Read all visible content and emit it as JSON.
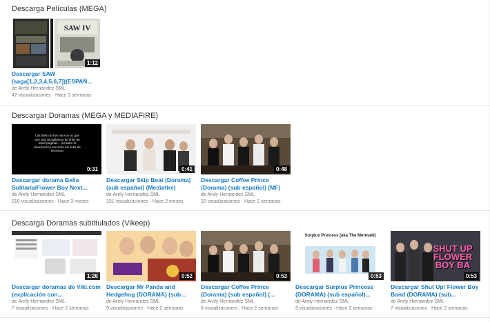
{
  "sections": [
    {
      "title": "Descarga Películas (MEGA)",
      "videos": [
        {
          "title": "Descargar SAW (saga[1,2,3,4,5,6,7])(ESPAÑ...",
          "channel": "de Arely Hernandez SML",
          "stats": "42 visualizaciones · Hace 2 semanas",
          "duration": "1:12"
        }
      ]
    },
    {
      "title": "Descargar Doramas (MEGA y MEDIAFIRE)",
      "videos": [
        {
          "title": "Descargar dorama Bella Solitaria/Flower Boy Next...",
          "channel": "de Arely Hernandez SML",
          "stats": "210 visualizaciones · Hace 3 meses",
          "duration": "0:31",
          "thumb_text": "Los links no son mios si no que son una recopilacion de links de otras paginas... (el autor lo desconozco encontre los links de terceros)"
        },
        {
          "title": "Descargar Skip Beat (Dorama) (sub español) (Mediafire)",
          "channel": "de Arely Hernandez SML",
          "stats": "151 visualizaciones · Hace 2 meses",
          "duration": "0:41"
        },
        {
          "title": "Descargar Coffee Prince (Dorama) (sub español) (MF)",
          "channel": "de Arely Hernandez SML",
          "stats": "20 visualizaciones · Hace 2 semanas",
          "duration": "0:48"
        }
      ]
    },
    {
      "title": "Descarga Doramas subtitulados (Vikeep)",
      "videos": [
        {
          "title": "Descargar doramas de Viki.com (explicación con...",
          "channel": "de Arely Hernandez SML",
          "stats": "7 visualizaciones · Hace 2 semanas",
          "duration": "1:26"
        },
        {
          "title": "Descargar Mr Panda and Hedgehog (DORAMA) (sub...",
          "channel": "de Arely Hernandez SML",
          "stats": "9 visualizaciones · Hace 2 semanas",
          "duration": "0:52"
        },
        {
          "title": "Descargar Coffee Prince (Dorama) (sub español) (...",
          "channel": "de Arely Hernandez SML",
          "stats": "6 visualizaciones · Hace 2 semanas",
          "duration": "0:53"
        },
        {
          "title": "Descargar Surplus Princess (DORAMA) (sub español)...",
          "channel": "de Arely Hernandez SML",
          "stats": "9 visualizaciones · Hace 2 semanas",
          "duration": "0:53",
          "thumb_text": "Surplus Princess (aka The Mermaid)"
        },
        {
          "title": "Descargar Shut Up! Flower Boy Band (DORAMA) (sub...",
          "channel": "de Arely Hernandez SML",
          "stats": "7 visualizaciones · Hace 2 semanas",
          "duration": "0:53",
          "thumb_text": "SHUT UP FLOWER BOY BA"
        }
      ]
    }
  ],
  "colors": {
    "link": "#167ac6",
    "meta": "#767676",
    "title": "#333333"
  }
}
